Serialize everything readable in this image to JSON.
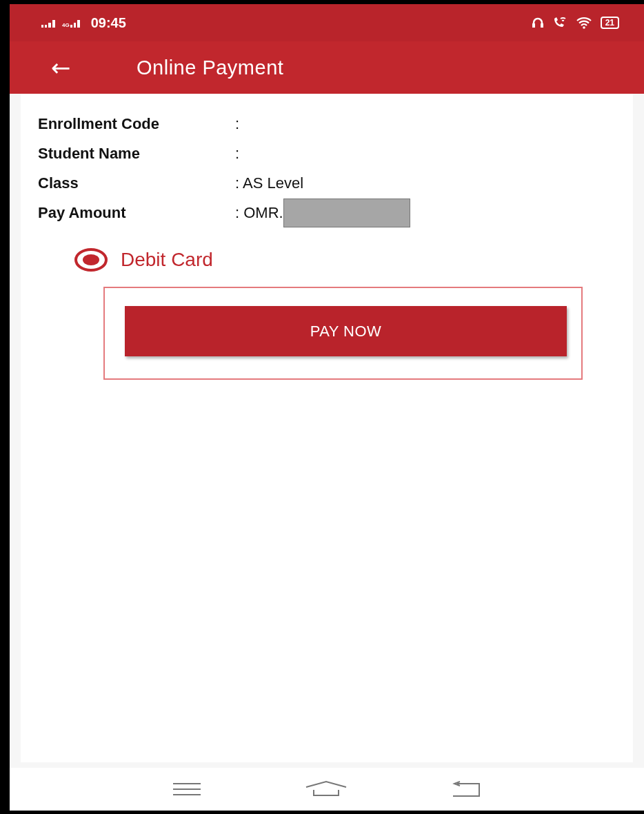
{
  "status_bar": {
    "network_label": "4G",
    "time": "09:45",
    "battery": "21"
  },
  "app_bar": {
    "back_icon": "←",
    "title": "Online Payment"
  },
  "details": [
    {
      "label": "Enrollment Code",
      "separator": ":",
      "value_hidden": false
    },
    {
      "label": "Student Name",
      "separator": ":",
      "value_hidden": false
    },
    {
      "label": "Class",
      "separator": ":",
      "value": "AS Level",
      "value_hidden": false
    },
    {
      "label": "Pay Amount",
      "separator": ":",
      "value": "OMR.",
      "value_hidden": true
    }
  ],
  "payment_methods": [
    {
      "label": "Debit Card",
      "selected": true
    }
  ],
  "pay_button": "PAY NOW"
}
